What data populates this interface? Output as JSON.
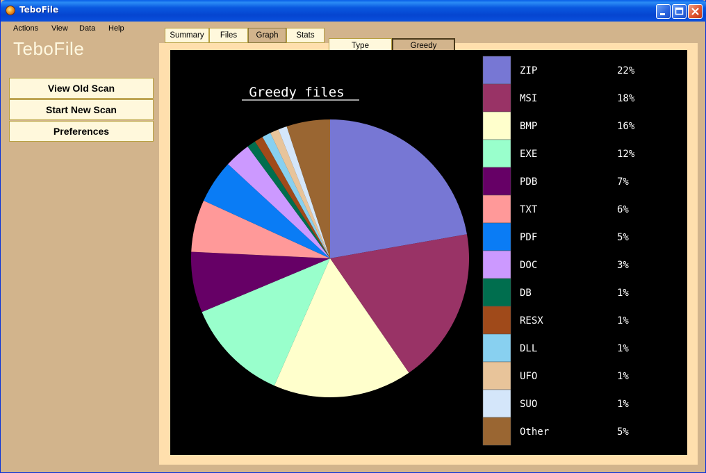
{
  "window": {
    "title": "TeboFile"
  },
  "menu": [
    "Actions",
    "View",
    "Data",
    "Help"
  ],
  "app_heading": "TeboFile",
  "side_buttons": [
    "View Old Scan",
    "Start New Scan",
    "Preferences"
  ],
  "tabs": [
    {
      "label": "Summary",
      "active": false
    },
    {
      "label": "Files",
      "active": false
    },
    {
      "label": "Graph",
      "active": true
    },
    {
      "label": "Stats",
      "active": false
    }
  ],
  "subtabs": [
    {
      "label": "Type",
      "active": false
    },
    {
      "label": "Greedy",
      "active": true
    }
  ],
  "chart_data": {
    "type": "pie",
    "title": "Greedy files",
    "categories": [
      "ZIP",
      "MSI",
      "BMP",
      "EXE",
      "PDB",
      "TXT",
      "PDF",
      "DOC",
      "DB",
      "RESX",
      "DLL",
      "UFO",
      "SUO",
      "Other"
    ],
    "values": [
      22,
      18,
      16,
      12,
      7,
      6,
      5,
      3,
      1,
      1,
      1,
      1,
      1,
      5
    ],
    "labels": [
      "22%",
      "18%",
      "16%",
      "12%",
      "7%",
      "6%",
      "5%",
      "3%",
      "1%",
      "1%",
      "1%",
      "1%",
      "1%",
      "5%"
    ],
    "colors": [
      "#7777d4",
      "#993366",
      "#ffffcc",
      "#99ffcc",
      "#660066",
      "#ff9999",
      "#0a7cf5",
      "#cc99ff",
      "#006e4e",
      "#a04a1a",
      "#88d0f0",
      "#e8c49a",
      "#d4e6fa",
      "#9a6632"
    ],
    "legend_position": "right"
  }
}
